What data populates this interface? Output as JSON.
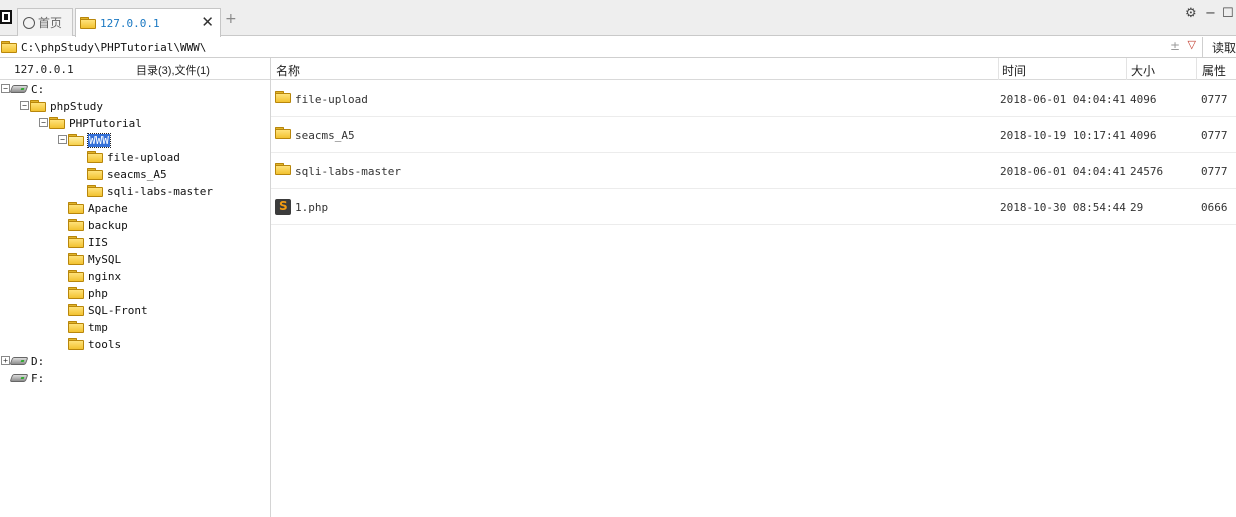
{
  "tabs": {
    "home_label": "首页",
    "active_label": "127.0.0.1",
    "close_glyph": "✕",
    "add_glyph": "+"
  },
  "window_controls": {
    "settings": "⚙",
    "minimize": "−",
    "maximize": "☐"
  },
  "address": {
    "path": "C:\\phpStudy\\PHPTutorial\\WWW\\",
    "pin_glyph": "±",
    "dropdown_glyph": "▽",
    "read_button": "读取"
  },
  "left_panel": {
    "host": "127.0.0.1",
    "summary": "目录(3),文件(1)"
  },
  "tree": [
    {
      "label": "C:",
      "icon": "drive-icon",
      "toggle": "−"
    },
    {
      "label": "phpStudy",
      "icon": "folder-icon",
      "toggle": "−"
    },
    {
      "label": "PHPTutorial",
      "icon": "folder-icon",
      "toggle": "−"
    },
    {
      "label": "WWW",
      "icon": "folder-open-icon",
      "toggle": "−",
      "selected": true
    },
    {
      "label": "file-upload",
      "icon": "folder-icon",
      "toggle": ""
    },
    {
      "label": "seacms_A5",
      "icon": "folder-icon",
      "toggle": ""
    },
    {
      "label": "sqli-labs-master",
      "icon": "folder-icon",
      "toggle": ""
    },
    {
      "label": "Apache",
      "icon": "folder-icon",
      "toggle": ""
    },
    {
      "label": "backup",
      "icon": "folder-icon",
      "toggle": ""
    },
    {
      "label": "IIS",
      "icon": "folder-icon",
      "toggle": ""
    },
    {
      "label": "MySQL",
      "icon": "folder-icon",
      "toggle": ""
    },
    {
      "label": "nginx",
      "icon": "folder-icon",
      "toggle": ""
    },
    {
      "label": "php",
      "icon": "folder-icon",
      "toggle": ""
    },
    {
      "label": "SQL-Front",
      "icon": "folder-icon",
      "toggle": ""
    },
    {
      "label": "tmp",
      "icon": "folder-icon",
      "toggle": ""
    },
    {
      "label": "tools",
      "icon": "folder-icon",
      "toggle": ""
    },
    {
      "label": "D:",
      "icon": "drive-icon",
      "toggle": "+"
    },
    {
      "label": "F:",
      "icon": "drive-icon",
      "toggle": ""
    }
  ],
  "columns": {
    "name": "名称",
    "time": "时间",
    "size": "大小",
    "attr": "属性"
  },
  "files": [
    {
      "name": "file-upload",
      "time": "2018-06-01 04:04:41",
      "size": "4096",
      "attr": "0777",
      "icon": "folder-icon"
    },
    {
      "name": "seacms_A5",
      "time": "2018-10-19 10:17:41",
      "size": "4096",
      "attr": "0777",
      "icon": "folder-icon"
    },
    {
      "name": "sqli-labs-master",
      "time": "2018-06-01 04:04:41",
      "size": "24576",
      "attr": "0777",
      "icon": "folder-icon"
    },
    {
      "name": "1.php",
      "time": "2018-10-30 08:54:44",
      "size": "29",
      "attr": "0666",
      "icon": "php-file-icon"
    }
  ]
}
